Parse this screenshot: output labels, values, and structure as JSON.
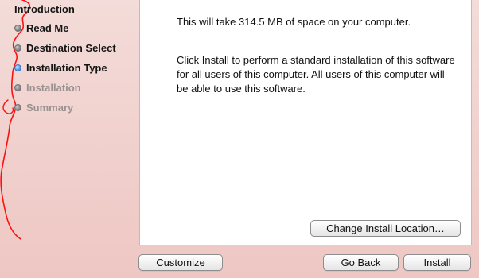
{
  "installer": {
    "steps": [
      {
        "label": "Introduction",
        "state": "done"
      },
      {
        "label": "Read Me",
        "state": "done"
      },
      {
        "label": "Destination Select",
        "state": "done"
      },
      {
        "label": "Installation Type",
        "state": "current"
      },
      {
        "label": "Installation",
        "state": "upcoming"
      },
      {
        "label": "Summary",
        "state": "upcoming"
      }
    ],
    "content": {
      "space_message": "This will take 314.5 MB of space on your computer.",
      "install_message": "Click Install to perform a standard installation of this software for all users of this computer. All users of this computer will be able to use this software."
    },
    "buttons": {
      "change_location": "Change Install Location…",
      "customize": "Customize",
      "go_back": "Go Back",
      "install": "Install"
    },
    "colors": {
      "sidebar_background": "#f1d2cf",
      "current_step_dot": "#4f95e8",
      "inactive_step_text": "#9a9191",
      "red_annotation": "#ff1010"
    }
  }
}
